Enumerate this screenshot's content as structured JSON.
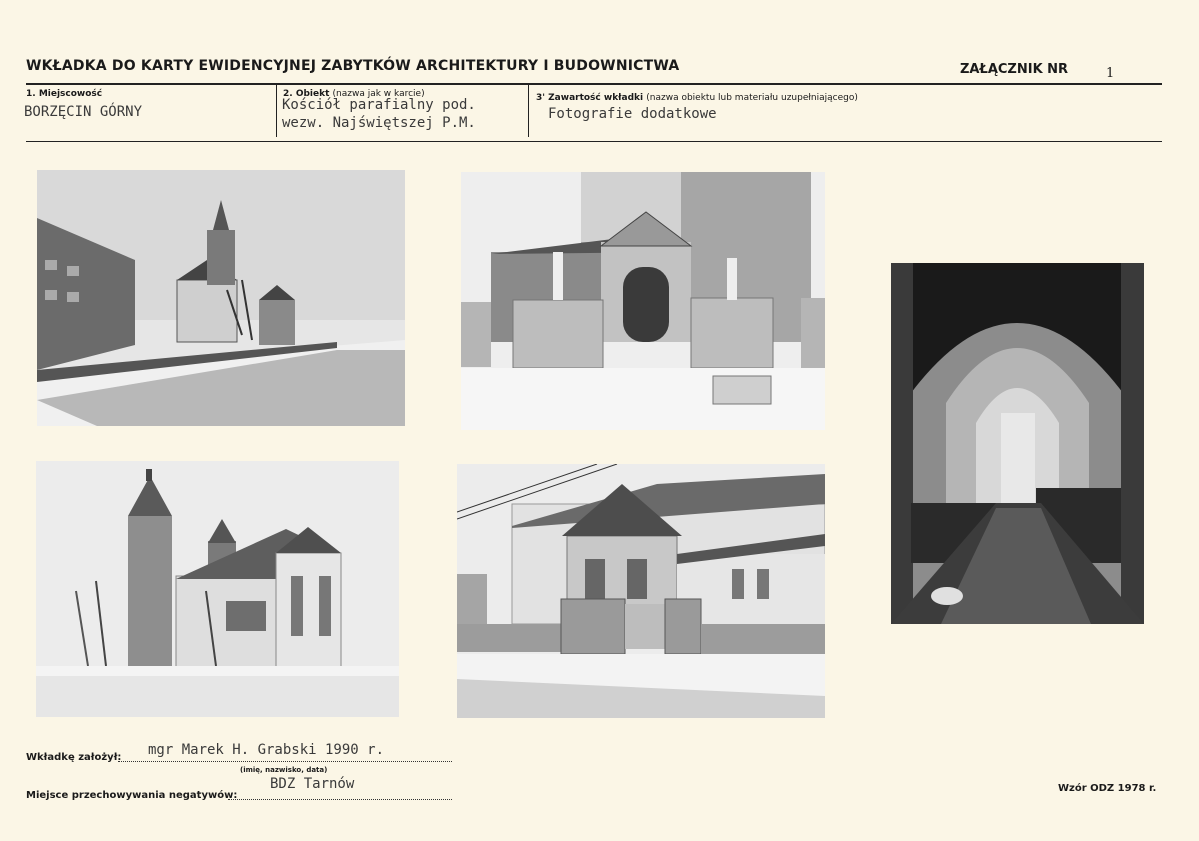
{
  "header": {
    "title": "WKŁADKA DO KARTY EWIDENCYJNEJ ZABYTKÓW ARCHITEKTURY I BUDOWNICTWA",
    "annex_label": "ZAŁĄCZNIK NR",
    "annex_number": "1"
  },
  "fields": {
    "location": {
      "label": "1. Miejscowość",
      "value": "BORZĘCIN GÓRNY"
    },
    "object": {
      "label": "2. Obiekt",
      "label_note": "(nazwa jak w karcie)",
      "value_line1": "Kościół parafialny pod.",
      "value_line2": "wezw. Najświętszej P.M."
    },
    "contents": {
      "label": "3' Zawartość wkładki",
      "label_note": "(nazwa obiektu lub materiału uzupełniającego)",
      "value": "Fotografie dodatkowe"
    }
  },
  "photos": [
    {
      "subject": "church-distant-road-winter"
    },
    {
      "subject": "church-gate-facade-winter"
    },
    {
      "subject": "church-interior-nave"
    },
    {
      "subject": "church-side-view-towers-winter"
    },
    {
      "subject": "church-apse-fence-winter"
    }
  ],
  "footer": {
    "founder_label": "Wkładkę założył:",
    "founder_value": "mgr Marek H. Grabski 1990 r.",
    "founder_sub": "(imię, nazwisko, data)",
    "storage_label": "Miejsce przechowywania negatywów:",
    "storage_value": "BDZ Tarnów",
    "form_code": "Wzór ODZ 1978 r."
  }
}
